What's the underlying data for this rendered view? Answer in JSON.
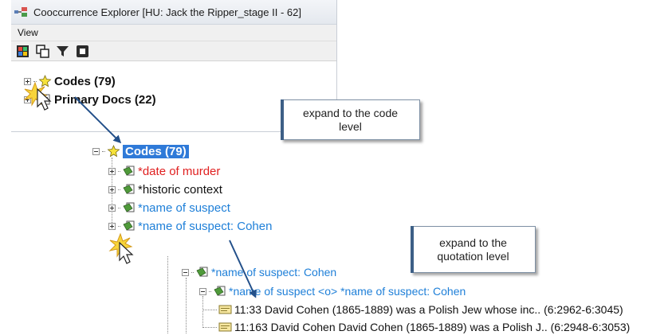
{
  "window": {
    "title": "Cooccurrence Explorer  [HU: Jack the Ripper_stage II - 62]",
    "menu": [
      "View"
    ],
    "toolbar_icons": [
      "color-palette-icon",
      "copy-windows-icon",
      "filter-icon",
      "stop-icon"
    ],
    "tree": [
      {
        "label": "Codes (79)"
      },
      {
        "label": "Primary Docs (22)"
      }
    ]
  },
  "callouts": {
    "code_level": "expand to the code level",
    "quotation_level": "expand to the quotation level"
  },
  "codes_tree": {
    "root": "Codes (79)",
    "children": [
      {
        "label": "*date of murder",
        "color": "#e02020"
      },
      {
        "label": "*historic context",
        "color": "#111111"
      },
      {
        "label": "*name of suspect",
        "color": "#1e7fd8"
      },
      {
        "label": "*name of suspect: Cohen",
        "color": "#1e7fd8"
      }
    ]
  },
  "quotation_tree": {
    "root": "*name of suspect: Cohen",
    "child": "*name of suspect <o> *name of suspect: Cohen",
    "quotations": [
      "11:33 David Cohen (1865-1889) was a Polish Jew whose inc.. (6:2962-6:3045)",
      "11:163 David Cohen David Cohen (1865-1889) was a Polish J.. (6:2948-6:3053)"
    ]
  },
  "colors": {
    "selection": "#2f7ad8",
    "code_blue": "#1e7fd8",
    "code_red": "#e02020",
    "arrow": "#23508a"
  }
}
